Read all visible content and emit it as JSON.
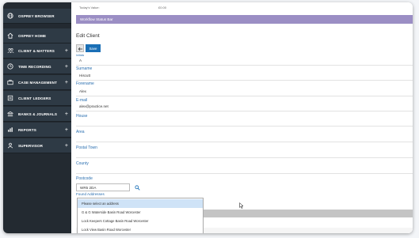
{
  "sidebar": {
    "items": [
      {
        "label": "OSPREY BROWSER",
        "icon": "globe-icon",
        "expandable": false
      },
      {
        "label": "OSPREY HOME",
        "icon": "home-icon",
        "expandable": false
      },
      {
        "label": "CLIENT & MATTERS",
        "icon": "people-icon",
        "expandable": true
      },
      {
        "label": "TIME RECORDING",
        "icon": "clock-icon",
        "expandable": true
      },
      {
        "label": "CASE MANAGEMENT",
        "icon": "briefcase-icon",
        "expandable": true
      },
      {
        "label": "CLIENT LEDGERS",
        "icon": "ledger-icon",
        "expandable": false
      },
      {
        "label": "BANKS & JOURNALS",
        "icon": "bank-icon",
        "expandable": true
      },
      {
        "label": "REPORTS",
        "icon": "report-icon",
        "expandable": true
      },
      {
        "label": "SUPERVISOR",
        "icon": "supervisor-icon",
        "expandable": true
      }
    ],
    "plus_glyph": "+"
  },
  "header": {
    "todays_value_label": "Today's Value:",
    "todays_value": "£0.00"
  },
  "workflow_bar": "Workflow Status Bar",
  "page_title": "Edit Client",
  "toolbar": {
    "back_icon": "arrow-left-icon",
    "save_label": "Save"
  },
  "form": {
    "initials_label": "Initials",
    "initials_value": "A",
    "surname_label": "Surname",
    "surname_value": "Hiscutt",
    "forename_label": "Forename",
    "forename_value": "Alex",
    "email_label": "E-mail",
    "email_value": "alex@practice.net",
    "house_label": "House",
    "area_label": "Area",
    "postal_town_label": "Postal Town",
    "county_label": "County",
    "postcode_label": "Postcode",
    "postcode_value": "WR5 2DA",
    "found_addresses_label": "Found Addresses"
  },
  "address_dropdown": {
    "options": [
      "Please select an address",
      "G & G Waterside Basin Road Worcester",
      "Lock Keepers Cottage Basin Road Worcester",
      "Lock View Basin Road Worcester"
    ],
    "selected_index": 0
  },
  "colors": {
    "sidebar_bg": "#232a31",
    "sidebar_item_bg": "#2e3a45",
    "workflow_bar": "#9b8ec4",
    "save_button": "#1a6fb6",
    "field_label": "#2a6fb0",
    "dropdown_selected": "#cfe3f7"
  }
}
